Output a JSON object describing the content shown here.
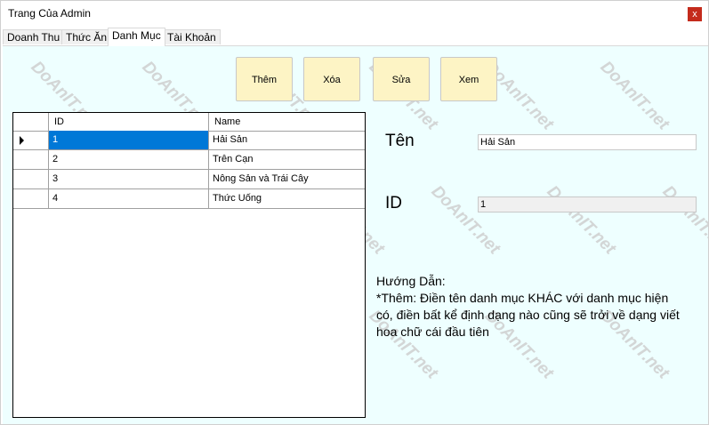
{
  "window": {
    "title": "Trang Của Admin",
    "close_glyph": "x"
  },
  "tabs": [
    {
      "label": "Doanh Thu"
    },
    {
      "label": "Thức Ăn"
    },
    {
      "label": "Danh Mục"
    },
    {
      "label": "Tài Khoản"
    }
  ],
  "active_tab": "Danh Mục",
  "actions": {
    "add": "Thêm",
    "delete": "Xóa",
    "edit": "Sửa",
    "view": "Xem"
  },
  "grid": {
    "columns": [
      "ID",
      "Name"
    ],
    "rows": [
      {
        "id": "1",
        "name": "Hải Sản"
      },
      {
        "id": "2",
        "name": "Trên Cạn"
      },
      {
        "id": "3",
        "name": "Nông Sản và Trái Cây"
      },
      {
        "id": "4",
        "name": "Thức Uống"
      }
    ],
    "selected_row": 0
  },
  "form": {
    "name_label": "Tên",
    "name_value": "Hải Sản",
    "id_label": "ID",
    "id_value": "1"
  },
  "guide": {
    "heading": "Hướng Dẫn:",
    "text": "*Thêm: Điền tên danh mục KHÁC với danh mục hiện có,  điền bất kể định dạng nào cũng sẽ trởi về dạng viết hoa chữ cái đầu tiên"
  },
  "watermark": "DoAnIT.net",
  "colors": {
    "content_bg": "#eeffff",
    "button_bg": "#fdf4c5",
    "selection": "#0078d7",
    "close_button": "#c42b1c"
  }
}
